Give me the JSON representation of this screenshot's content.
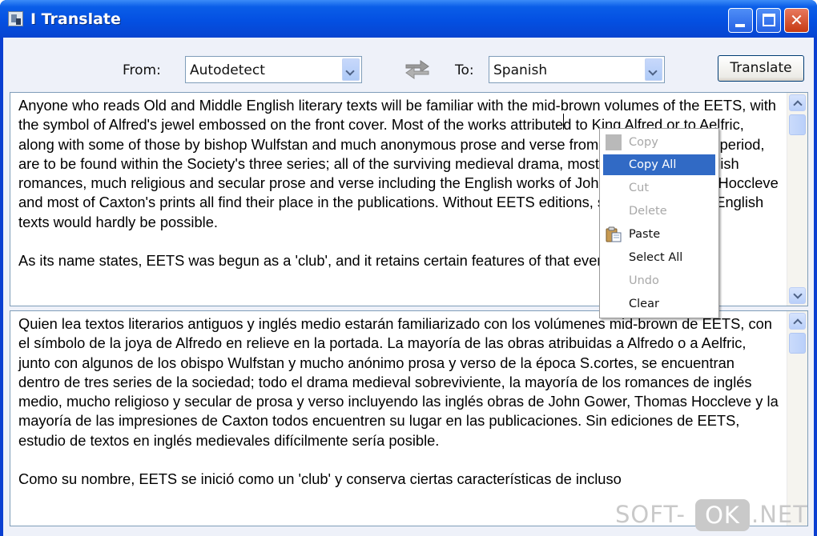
{
  "window": {
    "title": "I Translate",
    "app_icon": "app-icon"
  },
  "toolbar": {
    "from_label": "From:",
    "from_value": "Autodetect",
    "to_label": "To:",
    "to_value": "Spanish",
    "swap_icon": "swap-arrows-icon",
    "translate_label": "Translate"
  },
  "source": {
    "paragraphs": [
      "Anyone who reads Old and Middle English literary texts will be familiar with the mid-brown volumes of the EETS, with the symbol of Alfred's jewel embossed on the front cover. Most of the works attributed to King Alfred or to Aelfric, along with some of those by bishop Wulfstan and much anonymous prose and verse from the pre-Conquest period, are to be found within the Society's three series; all of the surviving medieval drama, most of the Middle English romances, much religious and secular prose and verse including the English works of John Gower, Thomas Hoccleve and most of Caxton's prints all find their place in the publications. Without EETS editions, study of medieval English texts would hardly be possible.",
      "As its name states, EETS was begun as a 'club', and it retains certain features of that even now. It"
    ]
  },
  "target": {
    "paragraphs": [
      "Quien lea textos literarios antiguos y inglés medio estarán familiarizado con los volúmenes mid-brown de EETS, con el símbolo de la joya de Alfredo en relieve en la portada. La mayoría de las obras atribuidas a Alfredo o a Aelfric, junto con algunos de los obispo Wulfstan y mucho anónimo prosa y verso de la época S.cortes, se encuentran dentro de tres series de la sociedad; todo el drama medieval sobreviviente, la mayoría de los romances de inglés medio, mucho religioso y secular de prosa y verso incluyendo las inglés obras de John Gower, Thomas Hoccleve y la mayoría de las impresiones de Caxton todos encuentren su lugar en las publicaciones. Sin ediciones de EETS, estudio de textos en inglés medievales difícilmente sería posible.",
      "Como su nombre, EETS se inició como un 'club' y conserva ciertas características de incluso"
    ]
  },
  "context_menu": {
    "items": [
      {
        "label": "Copy",
        "enabled": false,
        "selected": false,
        "icon": "copy-icon"
      },
      {
        "label": "Copy All",
        "enabled": true,
        "selected": true,
        "icon": ""
      },
      {
        "label": "Cut",
        "enabled": false,
        "selected": false,
        "icon": ""
      },
      {
        "label": "Delete",
        "enabled": false,
        "selected": false,
        "icon": ""
      },
      {
        "label": "Paste",
        "enabled": true,
        "selected": false,
        "icon": "paste-icon"
      },
      {
        "label": "Select All",
        "enabled": true,
        "selected": false,
        "icon": ""
      },
      {
        "label": "Undo",
        "enabled": false,
        "selected": false,
        "icon": ""
      },
      {
        "label": "Clear",
        "enabled": true,
        "selected": false,
        "icon": ""
      }
    ]
  },
  "watermark": {
    "left": "SOFT-",
    "box": "OK",
    "right": ".NET"
  },
  "colors": {
    "titlebar": "#0450e2",
    "client_bg": "#eef1f9",
    "menu_highlight": "#316ac5",
    "disabled_text": "#a8a8a8"
  }
}
